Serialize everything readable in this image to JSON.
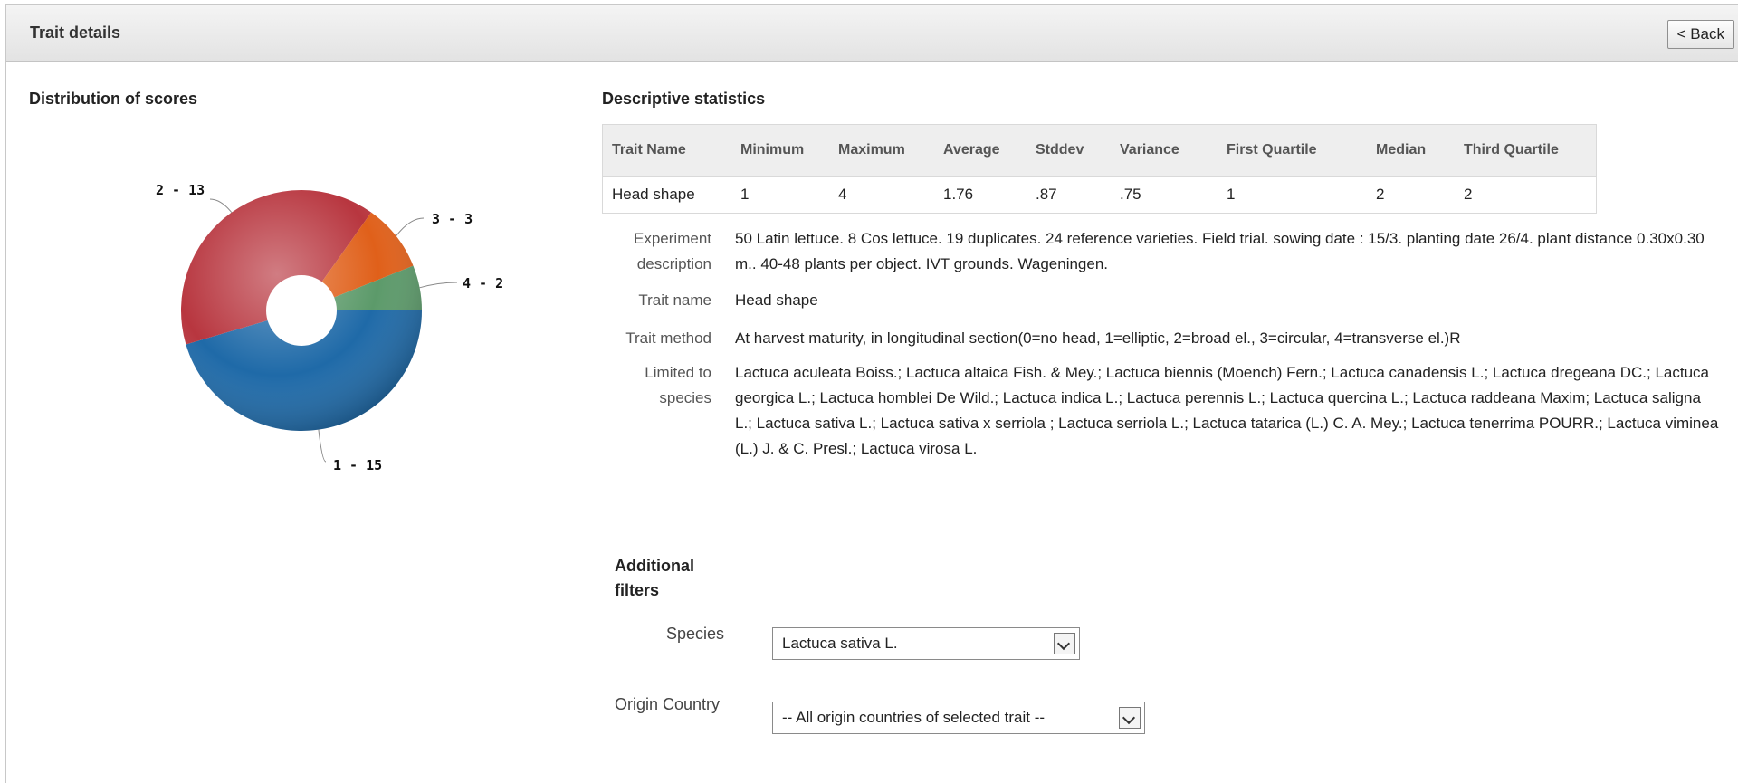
{
  "header": {
    "title": "Trait details",
    "back_label": "< Back"
  },
  "distribution": {
    "title": "Distribution of scores",
    "labels": [
      "1 - 15",
      "2 - 13",
      "3 - 3",
      "4 - 2"
    ]
  },
  "chart_data": {
    "type": "pie",
    "title": "Distribution of scores",
    "categories": [
      "1",
      "2",
      "3",
      "4"
    ],
    "values": [
      15,
      13,
      3,
      2
    ],
    "colors": [
      "#1f6aa8",
      "#b8363f",
      "#e0601a",
      "#5c9a6a"
    ],
    "donut": true
  },
  "stats": {
    "title": "Descriptive statistics",
    "headers": [
      "Trait Name",
      "Minimum",
      "Maximum",
      "Average",
      "Stddev",
      "Variance",
      "First Quartile",
      "Median",
      "Third Quartile"
    ],
    "row": [
      "Head shape",
      "1",
      "4",
      "1.76",
      ".87",
      ".75",
      "1",
      "2",
      "2"
    ]
  },
  "details": {
    "experiment_label": "Experiment description",
    "experiment_value": "50 Latin lettuce. 8 Cos lettuce. 19 duplicates. 24 reference varieties. Field trial. sowing date : 15/3. planting date 26/4. plant distance 0.30x0.30 m.. 40-48 plants per object. IVT grounds. Wageningen.",
    "trait_name_label": "Trait name",
    "trait_name_value": "Head shape",
    "trait_method_label": "Trait method",
    "trait_method_value": "At harvest maturity, in longitudinal section(0=no head, 1=elliptic, 2=broad el., 3=circular, 4=transverse el.)R",
    "species_label": "Limited to species",
    "species_value": "Lactuca aculeata Boiss.; Lactuca altaica Fish. & Mey.; Lactuca biennis (Moench) Fern.; Lactuca canadensis L.; Lactuca dregeana DC.; Lactuca georgica L.; Lactuca homblei De Wild.; Lactuca indica L.; Lactuca perennis L.; Lactuca quercina L.; Lactuca raddeana Maxim; Lactuca saligna L.; Lactuca sativa L.; Lactuca sativa x serriola ; Lactuca serriola L.; Lactuca tatarica (L.) C. A. Mey.; Lactuca tenerrima POURR.; Lactuca viminea (L.) J. & C. Presl.; Lactuca virosa L."
  },
  "filters": {
    "title": "Additional filters",
    "species_label": "Species",
    "species_selected": "Lactuca sativa L.",
    "country_label": "Origin Country",
    "country_selected": "-- All origin countries of selected trait --"
  }
}
